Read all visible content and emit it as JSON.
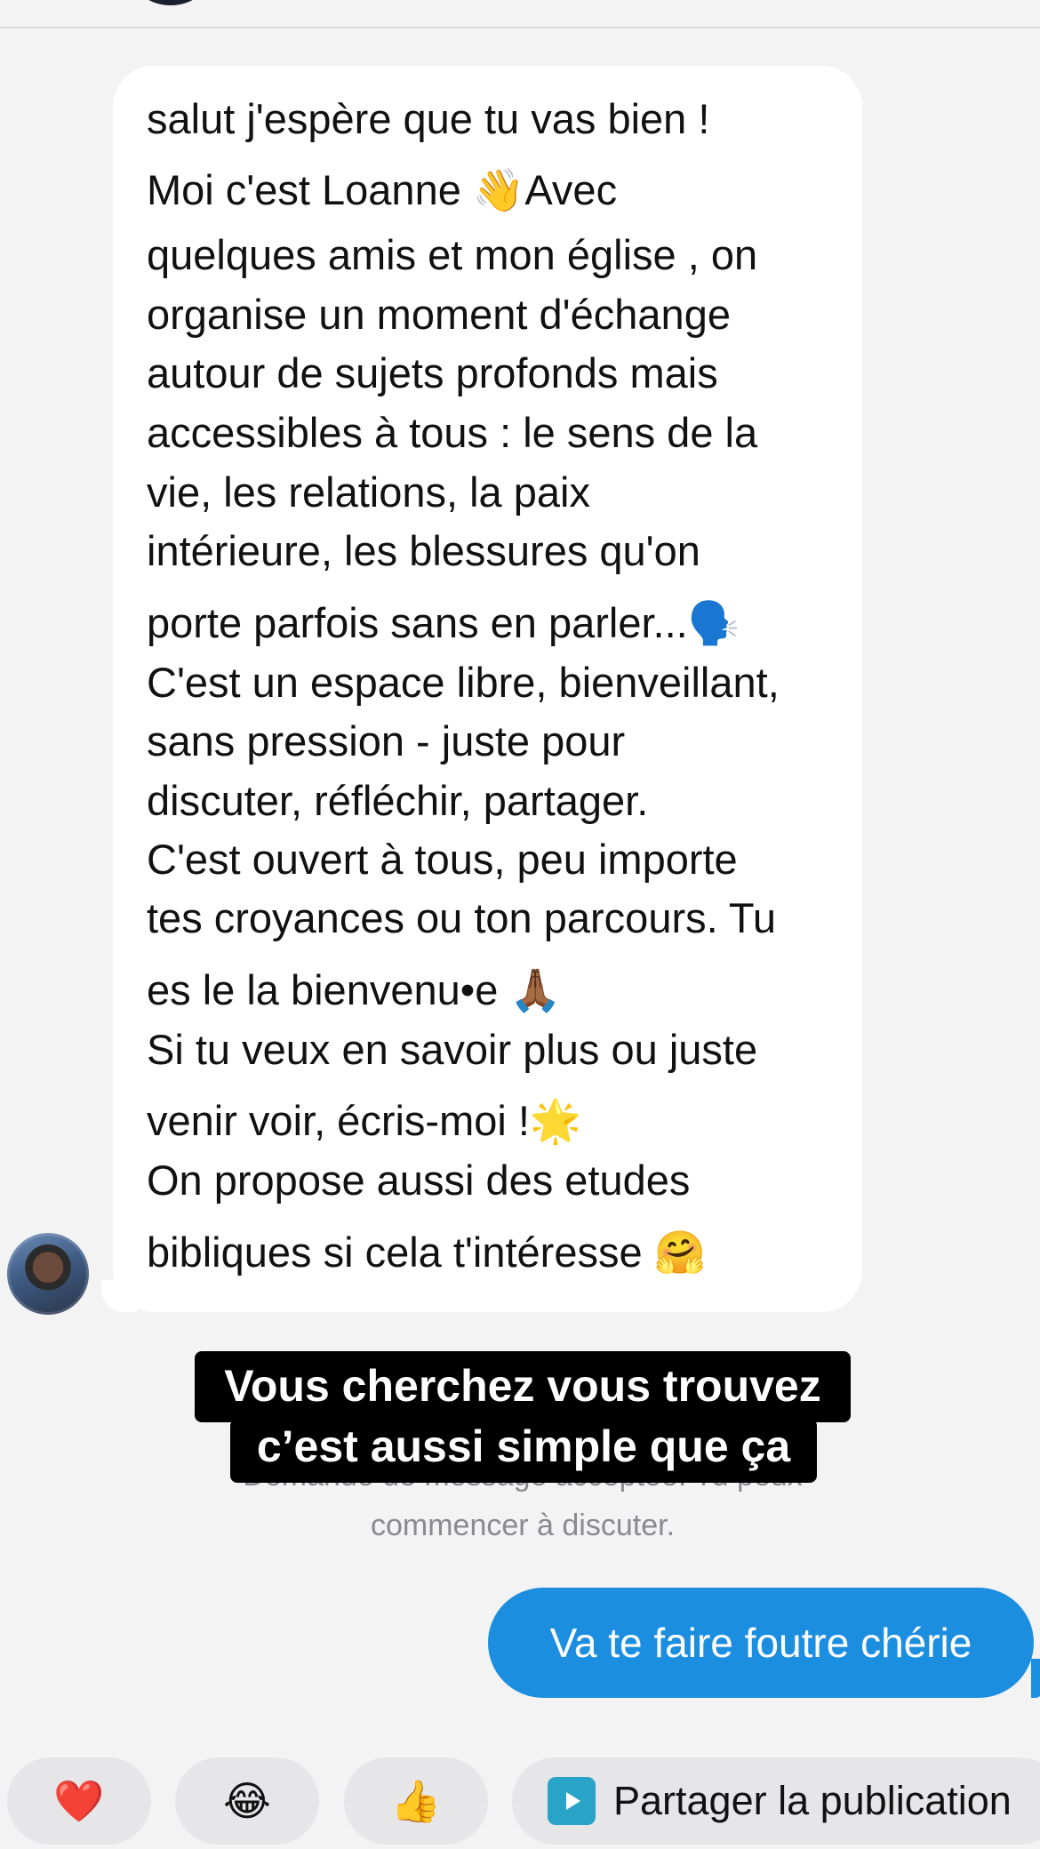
{
  "message_incoming": {
    "lines": [
      "salut j'espère que tu vas bien !",
      "Moi c'est Loanne 👋Avec",
      "quelques amis et mon église , on",
      "organise un moment d'échange",
      "autour de sujets profonds mais",
      "accessibles à tous : le sens de la",
      "vie, les relations, la paix",
      "intérieure, les blessures qu'on",
      "porte parfois sans en parler...🗣️",
      "C'est un espace libre, bienveillant,",
      "sans pression - juste pour",
      "discuter, réfléchir, partager.",
      "C'est ouvert à tous, peu importe",
      "tes croyances ou ton parcours. Tu",
      "es le la bienvenu•e 🙏🏾",
      "Si tu veux en savoir plus ou juste",
      "venir voir, écris-moi !🌟",
      "On propose aussi des etudes",
      "bibliques si cela t'intéresse 🤗"
    ]
  },
  "caption": {
    "line1": "Vous cherchez vous trouvez",
    "line2": "c’est aussi simple que ça"
  },
  "notice": {
    "line1": "Demande de message acceptée. Tu peux",
    "line2": "commencer à discuter."
  },
  "message_outgoing": {
    "text": "Va te faire foutre chérie"
  },
  "quick_replies": {
    "heart": "❤️",
    "laugh": "😂",
    "thumb": "👍",
    "share_label": "Partager la publication"
  },
  "colors": {
    "outgoing_bubble": "#1b8ee0",
    "share_icon": "#2aa3c9"
  }
}
